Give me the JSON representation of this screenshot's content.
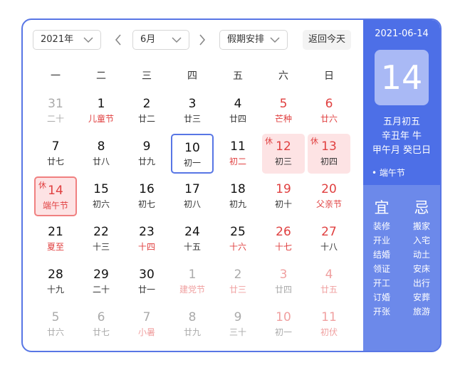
{
  "header": {
    "year": "2021年",
    "month": "6月",
    "holiday": "假期安排",
    "today_button": "返回今天"
  },
  "weekdays": [
    "一",
    "二",
    "三",
    "四",
    "五",
    "六",
    "日"
  ],
  "badge_rest": "休",
  "days": [
    {
      "day": "31",
      "lunar": "二十"
    },
    {
      "day": "1",
      "lunar": "儿童节"
    },
    {
      "day": "2",
      "lunar": "廿二"
    },
    {
      "day": "3",
      "lunar": "廿三"
    },
    {
      "day": "4",
      "lunar": "廿四"
    },
    {
      "day": "5",
      "lunar": "芒种"
    },
    {
      "day": "6",
      "lunar": "廿六"
    },
    {
      "day": "7",
      "lunar": "廿七"
    },
    {
      "day": "8",
      "lunar": "廿八"
    },
    {
      "day": "9",
      "lunar": "廿九"
    },
    {
      "day": "10",
      "lunar": "初一"
    },
    {
      "day": "11",
      "lunar": "初二"
    },
    {
      "day": "12",
      "lunar": "初三"
    },
    {
      "day": "13",
      "lunar": "初四"
    },
    {
      "day": "14",
      "lunar": "端午节"
    },
    {
      "day": "15",
      "lunar": "初六"
    },
    {
      "day": "16",
      "lunar": "初七"
    },
    {
      "day": "17",
      "lunar": "初八"
    },
    {
      "day": "18",
      "lunar": "初九"
    },
    {
      "day": "19",
      "lunar": "初十"
    },
    {
      "day": "20",
      "lunar": "父亲节"
    },
    {
      "day": "21",
      "lunar": "夏至"
    },
    {
      "day": "22",
      "lunar": "十三"
    },
    {
      "day": "23",
      "lunar": "十四"
    },
    {
      "day": "24",
      "lunar": "十五"
    },
    {
      "day": "25",
      "lunar": "十六"
    },
    {
      "day": "26",
      "lunar": "十七"
    },
    {
      "day": "27",
      "lunar": "十八"
    },
    {
      "day": "28",
      "lunar": "十九"
    },
    {
      "day": "29",
      "lunar": "二十"
    },
    {
      "day": "30",
      "lunar": "廿一"
    },
    {
      "day": "1",
      "lunar": "建党节"
    },
    {
      "day": "2",
      "lunar": "廿三"
    },
    {
      "day": "3",
      "lunar": "廿四"
    },
    {
      "day": "4",
      "lunar": "廿五"
    },
    {
      "day": "5",
      "lunar": "廿六"
    },
    {
      "day": "6",
      "lunar": "廿七"
    },
    {
      "day": "7",
      "lunar": "小暑"
    },
    {
      "day": "8",
      "lunar": "廿九"
    },
    {
      "day": "9",
      "lunar": "三十"
    },
    {
      "day": "10",
      "lunar": "初一"
    },
    {
      "day": "11",
      "lunar": "初伏"
    }
  ],
  "side": {
    "date": "2021-06-14",
    "day": "14",
    "lunar_date": "五月初五",
    "year_ganzhi": "辛丑年 牛",
    "month_day_ganzhi": "甲午月 癸巳日",
    "festival": "• 端午节",
    "yi_title": "宜",
    "ji_title": "忌",
    "yi": [
      "装修",
      "开业",
      "结婚",
      "领证",
      "开工",
      "订婚",
      "开张"
    ],
    "ji": [
      "搬家",
      "入宅",
      "动土",
      "安床",
      "出行",
      "安葬",
      "旅游"
    ]
  },
  "colors": {
    "accent": "#5876e5",
    "panel": "#4d6fe7",
    "panel_lower": "#6c89ea",
    "holiday_bg": "#fde3e4",
    "red": "#e04040"
  }
}
